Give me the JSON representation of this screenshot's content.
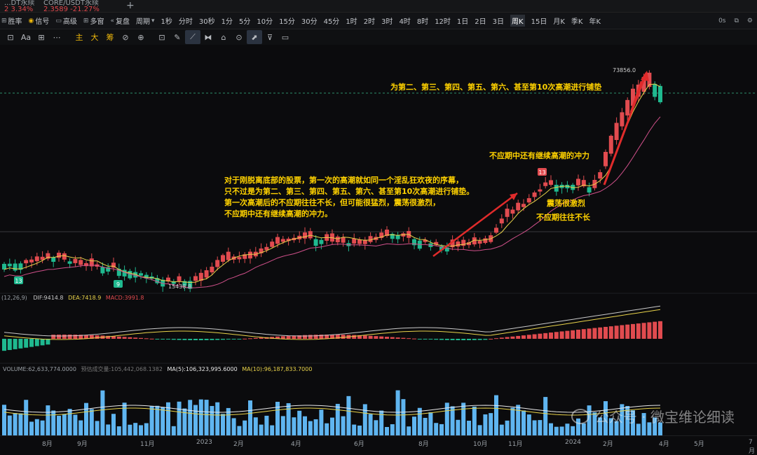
{
  "tabs": [
    {
      "name": "...DT永续",
      "sub": "2 3.34%"
    },
    {
      "name": "CORE/USDT永续",
      "sub": "2.3589 -21.27%"
    },
    {
      "name": "+",
      "sub": ""
    }
  ],
  "toolbar": {
    "items": [
      "胜率",
      "信号",
      "高级",
      "多窗",
      "复盘",
      "周期",
      "1秒",
      "分时",
      "30秒",
      "1分",
      "5分",
      "10分",
      "15分",
      "30分",
      "45分",
      "1时",
      "2时",
      "3时",
      "4时",
      "8时",
      "12时",
      "1日",
      "2日",
      "3日",
      "周K",
      "15日",
      "月K",
      "季K",
      "年K"
    ],
    "active": "周K",
    "right": [
      "0s",
      "⧉",
      "⚙"
    ]
  },
  "drawbar": {
    "items": [
      "⊡",
      "Aa",
      "⊞",
      "⋯",
      "主",
      "大",
      "筹",
      "⊘",
      "⊕",
      "⊡",
      "✎",
      "⟋",
      "⧓",
      "⌂",
      "⊙",
      "⬈",
      "⊽",
      "▭"
    ]
  },
  "price_labels": {
    "high": "73856.0",
    "low": "15438.8"
  },
  "signal_markers": [
    "13",
    "9",
    "13"
  ],
  "annotations": {
    "top": "为第二、第三、第四、第五、第六、甚至第10次高潮进行铺垫",
    "mid_right": "不应期中还有继续高潮的冲力",
    "main": [
      "对于刚脱离底部的股票，第一次的高潮就如同一个淫乱狂欢夜的序幕，",
      "只不过是为第二、第三、第四、第五、第六、甚至第10次高潮进行铺垫。",
      "第一次高潮后的不应期往往不长，但可能很猛烈，震荡很激烈，",
      "不应期中还有继续高潮的冲力。"
    ],
    "shake": "震荡很激烈",
    "short": "不应期往往不长"
  },
  "macd_labels": {
    "params": "(12,26,9)",
    "dif": "DIF:9414.8",
    "dea": "DEA:7418.9",
    "macd": "MACD:3991.8"
  },
  "volume_labels": {
    "volume": "VOLUME:62,633,774.0000",
    "estimate": "预估成交量:105,442,068.1382",
    "ma5": "MA(5):106,323,995.6000",
    "ma10": "MA(10):96,187,833.7000"
  },
  "x_axis": [
    "8月",
    "9月",
    "11月",
    "2023",
    "2月",
    "4月",
    "6月",
    "8月",
    "10月",
    "11月",
    "2024",
    "2月",
    "4月",
    "5月",
    "7月"
  ],
  "watermark": "公众号 · 微宝维论细读",
  "colors": {
    "up": "#e14b4f",
    "down": "#1fb98f",
    "ma1": "#e8d24a",
    "ma2": "#d0508a",
    "ma3": "#c9c9c9"
  }
}
